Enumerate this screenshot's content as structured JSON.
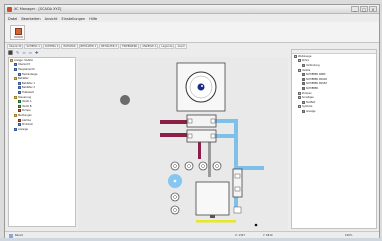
{
  "window": {
    "title": "XC Manager - [SCADA XYZ]",
    "controls": [
      "_",
      "□",
      "×"
    ]
  },
  "menu": [
    "Datei",
    "Bearbeiten",
    "Ansicht",
    "Einstellungen",
    "Hilfe"
  ],
  "tabs": [
    "Übersicht",
    "SCHEMA 1",
    "SCHEMA 2",
    "ELEKTRIK",
    "BEHÄLTER 1",
    "BEHÄLTER 2",
    "TRIEBWERK",
    "ANZEIGE A",
    "Legende",
    "Alarm"
  ],
  "toolbar": [
    "⬛",
    "✎",
    "⇦",
    "⇨",
    "✚"
  ],
  "left_tree": [
    {
      "label": "Anlage: SCADA",
      "level": 0,
      "icon": "folder"
    },
    {
      "label": "Übersicht",
      "level": 1,
      "icon": "blue"
    },
    {
      "label": "Hauptansicht",
      "level": 1,
      "icon": "blue"
    },
    {
      "label": "Tankanzeige",
      "level": 2,
      "icon": "blue"
    },
    {
      "label": "Behälter",
      "level": 1,
      "icon": "folder"
    },
    {
      "label": "Behälter 1",
      "level": 2,
      "icon": "blue"
    },
    {
      "label": "Behälter 2",
      "level": 2,
      "icon": "blue"
    },
    {
      "label": "Triebwerk",
      "level": 2,
      "icon": "blue"
    },
    {
      "label": "Steuerung",
      "level": 1,
      "icon": "folder"
    },
    {
      "label": "Ventil A",
      "level": 2,
      "icon": "green"
    },
    {
      "label": "Ventil B",
      "level": 2,
      "icon": "green"
    },
    {
      "label": "Pumpe",
      "level": 2,
      "icon": "red"
    },
    {
      "label": "Meldungen",
      "level": 1,
      "icon": "folder"
    },
    {
      "label": "Alarme",
      "level": 2,
      "icon": "red"
    },
    {
      "label": "Protokoll",
      "level": 2,
      "icon": "blue"
    },
    {
      "label": "Anzeige",
      "level": 1,
      "icon": "blue"
    }
  ],
  "right_tree": [
    {
      "label": "Werkzeuge",
      "level": 0,
      "color": "#e8c25a"
    },
    {
      "label": "Rohre",
      "level": 1,
      "color": "#e8c25a"
    },
    {
      "label": "Verbindung",
      "level": 2,
      "color": "#6aa0d8"
    },
    {
      "label": "Ventile",
      "level": 1,
      "color": "#e8c25a"
    },
    {
      "label": "SCHIEBER DN80",
      "level": 2,
      "color": "#d65a4a"
    },
    {
      "label": "SCHIEBER DN100",
      "level": 2,
      "color": "#d65a4a"
    },
    {
      "label": "SCHIEBER DN150",
      "level": 2,
      "color": "#d65a4a"
    },
    {
      "label": "SCHIEBER",
      "level": 2,
      "color": "#d65a4a"
    },
    {
      "label": "Pumpen",
      "level": 1,
      "color": "#e8c25a"
    },
    {
      "label": "Sonstiges",
      "level": 1,
      "color": "#e8c25a"
    },
    {
      "label": "Textfeld",
      "level": 2,
      "color": "#6aa0d8"
    },
    {
      "label": "Symbole",
      "level": 1,
      "color": "#e8c25a"
    },
    {
      "label": "Anzeige",
      "level": 2,
      "color": "#6aa0d8"
    }
  ],
  "status": {
    "left": "Bereit",
    "coord1": "X: 1327",
    "coord2": "Y: 4819",
    "zoom": "100%"
  }
}
